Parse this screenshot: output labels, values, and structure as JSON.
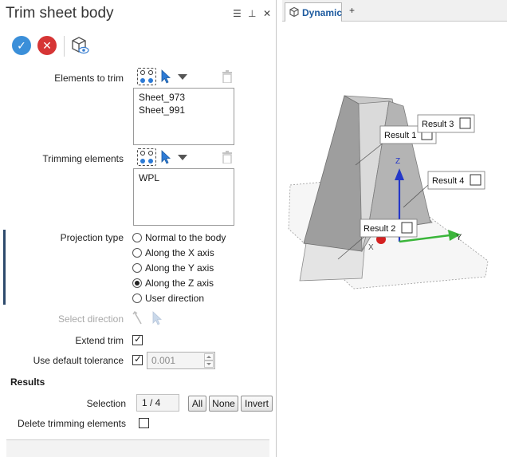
{
  "panel": {
    "title": "Trim sheet body",
    "header_controls": {
      "menu": "☰",
      "pin": "⊥",
      "close": "✕"
    },
    "toolbar": {
      "ok": "✓",
      "cancel": "✕"
    },
    "elements_to_trim": {
      "label": "Elements to trim",
      "items": [
        "Sheet_973",
        "Sheet_991"
      ]
    },
    "trimming_elements": {
      "label": "Trimming elements",
      "items": [
        "WPL"
      ]
    },
    "projection": {
      "label": "Projection type",
      "options": [
        "Normal to the body",
        "Along the X axis",
        "Along the Y axis",
        "Along the Z axis",
        "User direction"
      ],
      "selected_index": 3
    },
    "select_direction": {
      "label": "Select direction"
    },
    "extend_trim": {
      "label": "Extend trim",
      "checked": true
    },
    "tolerance": {
      "label": "Use default tolerance",
      "checked": true,
      "value": "0.001"
    },
    "results": {
      "header": "Results",
      "selection_label": "Selection",
      "selection_value": "1 / 4",
      "buttons": {
        "all": "All",
        "none": "None",
        "invert": "Invert"
      }
    },
    "delete_trimming": {
      "label": "Delete trimming elements",
      "checked": false
    }
  },
  "viewport": {
    "tab_label": "Dynamic",
    "add_tab": "+",
    "result_tags": [
      "Result 1",
      "Result 2",
      "Result 3",
      "Result 4"
    ],
    "axes": {
      "y": "Y",
      "z": "Z",
      "x": "X"
    }
  },
  "colors": {
    "accent_blue": "#3b8fd9",
    "cancel_red": "#d63535",
    "axis_green": "#3ab53a",
    "axis_blue": "#2538c8",
    "axis_red": "#d42020"
  }
}
